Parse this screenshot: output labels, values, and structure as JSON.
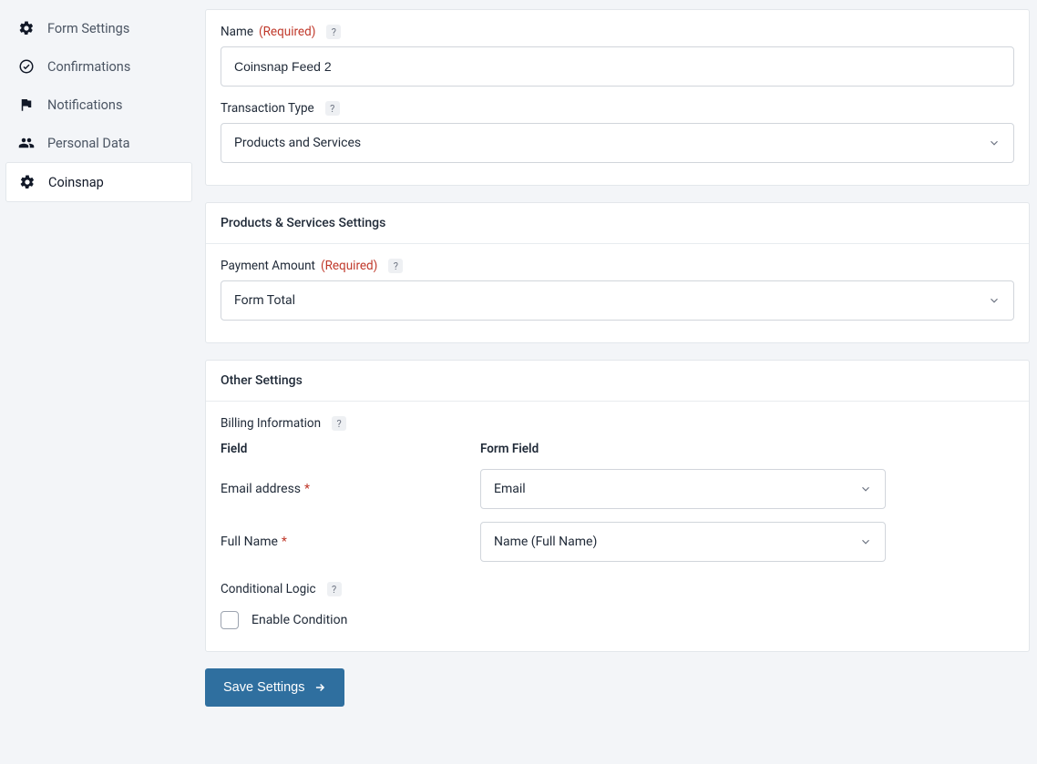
{
  "sidebar": {
    "items": [
      {
        "label": "Form Settings",
        "active": false
      },
      {
        "label": "Confirmations",
        "active": false
      },
      {
        "label": "Notifications",
        "active": false
      },
      {
        "label": "Personal Data",
        "active": false
      },
      {
        "label": "Coinsnap",
        "active": true
      }
    ]
  },
  "panel1": {
    "name_label": "Name",
    "name_required": "(Required)",
    "name_value": "Coinsnap Feed 2",
    "transaction_type_label": "Transaction Type",
    "transaction_type_value": "Products and Services"
  },
  "panel2": {
    "title": "Products & Services Settings",
    "payment_amount_label": "Payment Amount",
    "payment_amount_required": "(Required)",
    "payment_amount_value": "Form Total"
  },
  "panel3": {
    "title": "Other Settings",
    "billing_info_label": "Billing Information",
    "field_header": "Field",
    "form_field_header": "Form Field",
    "rows": [
      {
        "label": "Email address",
        "value": "Email"
      },
      {
        "label": "Full Name",
        "value": "Name (Full Name)"
      }
    ],
    "conditional_logic_label": "Conditional Logic",
    "enable_condition_label": "Enable Condition"
  },
  "actions": {
    "save_label": "Save Settings"
  },
  "help_glyph": "?"
}
